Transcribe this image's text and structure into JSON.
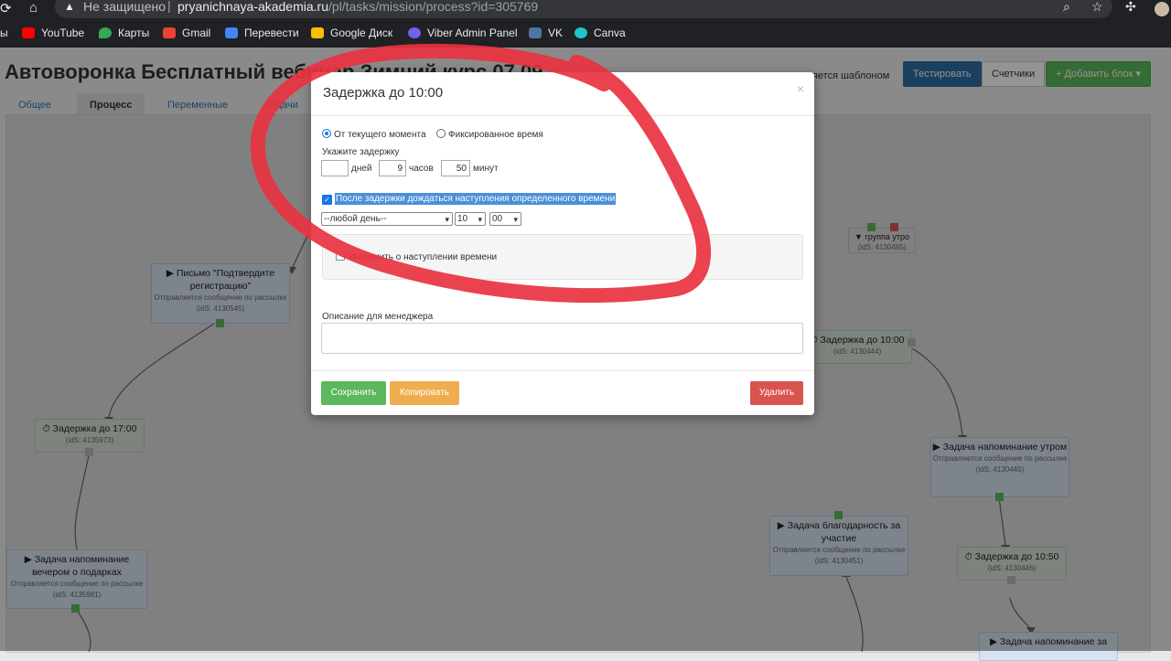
{
  "browser": {
    "security_label": "Не защищено",
    "url_domain": "pryanichnaya-akademia.ru",
    "url_path": "/pl/tasks/mission/process?id=305769",
    "bookmarks": [
      {
        "label": "ы",
        "color": "#202124"
      },
      {
        "label": "YouTube",
        "color": "#ff0000"
      },
      {
        "label": "Карты",
        "color": "#34a853"
      },
      {
        "label": "Gmail",
        "color": "#ea4335"
      },
      {
        "label": "Перевести",
        "color": "#4285f4"
      },
      {
        "label": "Google Диск",
        "color": "#fbbc04"
      },
      {
        "label": "Viber Admin Panel",
        "color": "#7360f2"
      },
      {
        "label": "VK",
        "color": "#4c75a3"
      },
      {
        "label": "Canva",
        "color": "#20c4cb"
      }
    ]
  },
  "page": {
    "title": "Автоворонка Бесплатный вебинар Зимний курс 07.09",
    "tabs": [
      "Общее",
      "Процесс",
      "Переменные",
      "Задачи"
    ],
    "template_label": "является шаблоном",
    "buttons": {
      "test": "Тестировать",
      "counters": "Счетчики",
      "add_block": "+ Добавить блок ▾"
    }
  },
  "nodes": [
    {
      "title": "▶ Письмо \"Подтвердите регистрацию\"",
      "sub": "Отправляется сообщение по рассылке (idS: 4130545)"
    },
    {
      "title": "⏱ Задержка до 17:00",
      "sub": "(idS: 4135973)"
    },
    {
      "title": "▶ Задача напоминание вечером о подарках",
      "sub": "Отправляется сообщение по рассылке (idS: 4135981)"
    },
    {
      "title": "▼ группа утро",
      "sub": "(idS: 4130485)"
    },
    {
      "title": "⏱ Задержка до 10:00",
      "sub": "(idS: 4130444)"
    },
    {
      "title": "▶ Задача напоминание утром",
      "sub": "Отправляются сообщение по рассылке (idS: 4130445)"
    },
    {
      "title": "▶ Задача благодарность за участие",
      "sub": "Отправляется сообщение по рассылке (idS: 4130451)"
    },
    {
      "title": "⏱ Задержка до 10:50",
      "sub": "(idS: 4130446)"
    },
    {
      "title": "▶ Задача напоминание за",
      "sub": ""
    }
  ],
  "modal": {
    "title": "Задержка до 10:00",
    "close": "×",
    "radio_current": "От текущего момента",
    "radio_fixed": "Фиксированное время",
    "delay_label": "Укажите задержку",
    "days_value": "",
    "days_label": "дней",
    "hours_value": "9",
    "hours_label": "часов",
    "minutes_value": "50",
    "minutes_label": "минут",
    "wait_checkbox": "После задержки дождаться наступления определенного времени",
    "day_select": "--любой день--",
    "hour_select": "10",
    "minute_select": "00",
    "notify_checkbox": "Уведомить о наступлении времени",
    "manager_desc_label": "Описание для менеджера",
    "manager_desc_value": "",
    "save": "Сохранить",
    "copy": "Копировать",
    "delete": "Удалить"
  },
  "colors": {
    "primary": "#337ab7",
    "success": "#5cb85c",
    "warning": "#f0ad4e",
    "danger": "#d9534f",
    "annotation": "#e8323f"
  }
}
